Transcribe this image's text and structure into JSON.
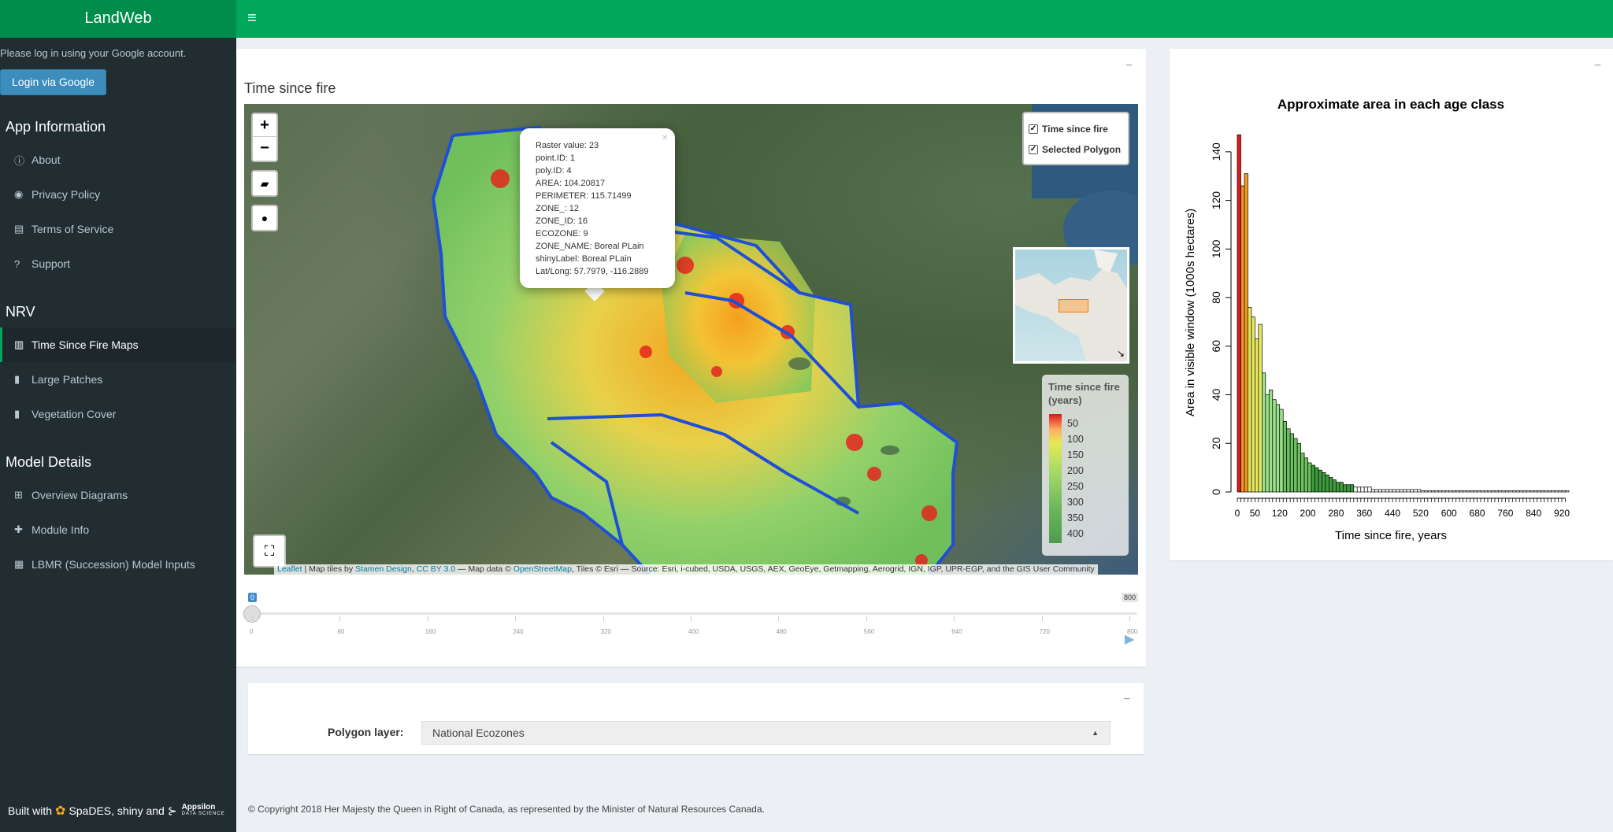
{
  "app": {
    "title": "LandWeb"
  },
  "sidebar": {
    "login_message": "Please log in using your Google account.",
    "login_button": "Login via Google",
    "section_app": "App Information",
    "app_items": [
      {
        "label": "About",
        "icon": "info-circle-icon"
      },
      {
        "label": "Privacy Policy",
        "icon": "eye-slash-icon"
      },
      {
        "label": "Terms of Service",
        "icon": "file-icon"
      },
      {
        "label": "Support",
        "icon": "question-circle-icon"
      }
    ],
    "section_nrv": "NRV",
    "nrv_items": [
      {
        "label": "Time Since Fire Maps",
        "icon": "map-icon",
        "active": true
      },
      {
        "label": "Large Patches",
        "icon": "bar-chart-icon"
      },
      {
        "label": "Vegetation Cover",
        "icon": "bar-chart-icon"
      }
    ],
    "section_model": "Model Details",
    "model_items": [
      {
        "label": "Overview Diagrams",
        "icon": "sitemap-icon"
      },
      {
        "label": "Module Info",
        "icon": "puzzle-icon"
      },
      {
        "label": "LBMR (Succession) Model Inputs",
        "icon": "table-icon"
      }
    ],
    "built_with": "Built with",
    "built_tools": "SpaDES, shiny and",
    "appsilon": "Appsilon",
    "appsilon_sub": "DATA SCIENCE"
  },
  "map_panel": {
    "title": "Time since fire",
    "layers": [
      "Time since fire",
      "Selected Polygon"
    ],
    "legend_title": "Time since fire (years)",
    "legend_labels": [
      "50",
      "100",
      "150",
      "200",
      "250",
      "300",
      "350",
      "400"
    ],
    "popup": [
      "Raster value: 23",
      "point.ID: 1",
      "poly.ID: 4",
      "AREA: 104.20817",
      "PERIMETER: 115.71499",
      "ZONE_: 12",
      "ZONE_ID: 16",
      "ECOZONE: 9",
      "ZONE_NAME: Boreal PLain",
      "shinyLabel: Boreal PLain",
      "Lat/Long: 57.7979, -116.2889"
    ],
    "attribution": {
      "leaflet": "Leaflet",
      "sep1": " | Map tiles by ",
      "stamen": "Stamen Design",
      "comma": ", ",
      "ccby": "CC BY 3.0",
      "mid": " — Map data © ",
      "osm": "OpenStreetMap",
      "tail": ", Tiles © Esri — Source: Esri, i-cubed, USDA, USGS, AEX, GeoEye, Getmapping, Aerogrid, IGN, IGP, UPR-EGP, and the GIS User Community"
    }
  },
  "slider": {
    "current": "0",
    "max_label": "800",
    "ticks": [
      "0",
      "80",
      "160",
      "240",
      "320",
      "400",
      "480",
      "560",
      "640",
      "720",
      "800"
    ]
  },
  "polygon": {
    "label": "Polygon layer:",
    "value": "National Ecozones"
  },
  "footer": "© Copyright 2018 Her Majesty the Queen in Right of Canada, as represented by the Minister of Natural Resources Canada.",
  "colors": {
    "header": "#00a65a",
    "logo": "#008d4c",
    "sidebar": "#222d32",
    "accent": "#3c8dbc"
  },
  "chart_data": {
    "type": "bar",
    "title": "Approximate area in each age class",
    "xlabel": "Time since fire, years",
    "ylabel": "Area in visible window (1000s hectares)",
    "xlim": [
      0,
      940
    ],
    "ylim": [
      0,
      150
    ],
    "bin_width": 10,
    "x_ticks": [
      "0",
      "50",
      "120",
      "200",
      "280",
      "360",
      "440",
      "520",
      "600",
      "680",
      "760",
      "840",
      "920"
    ],
    "y_ticks": [
      "0",
      "20",
      "40",
      "60",
      "80",
      "100",
      "120",
      "140"
    ],
    "values": [
      147,
      126,
      131,
      76,
      72,
      63,
      69,
      49,
      40,
      42,
      38,
      36,
      34,
      29,
      26,
      24,
      22,
      20,
      16,
      14,
      12,
      11,
      10,
      9,
      8,
      7,
      6,
      5,
      4,
      4,
      3,
      3,
      3,
      2,
      2,
      2,
      2,
      2,
      1,
      1,
      1,
      1,
      1,
      1,
      1,
      1,
      1,
      1,
      1,
      1,
      1,
      1,
      0.5,
      0.5,
      0.5,
      0.5,
      0.5,
      0.5,
      0.5,
      0.5,
      0.5,
      0.5,
      0.5,
      0.5,
      0.5,
      0.5,
      0.5,
      0.5,
      0.5,
      0.5,
      0.5,
      0.5,
      0.5,
      0.5,
      0.5,
      0.5,
      0.5,
      0.5,
      0.5,
      0.5,
      0.5,
      0.5,
      0.5,
      0.5,
      0.5,
      0.5,
      0.5,
      0.5,
      0.5,
      0.5,
      0.5,
      0.5,
      0.5,
      0.5
    ]
  }
}
